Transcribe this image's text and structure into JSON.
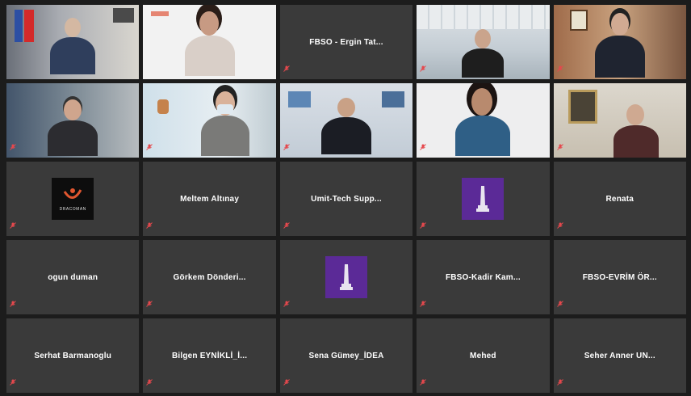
{
  "meeting": {
    "tiles": [
      {
        "type": "video",
        "label": "",
        "muted": false
      },
      {
        "type": "video",
        "label": "",
        "muted": false
      },
      {
        "type": "name",
        "name": "FBSO - Ergin Tat...",
        "label": "",
        "muted": true
      },
      {
        "type": "video",
        "label": "",
        "muted": true
      },
      {
        "type": "video",
        "label": "",
        "muted": true
      },
      {
        "type": "video",
        "label": "",
        "muted": true
      },
      {
        "type": "video",
        "label": "",
        "muted": true
      },
      {
        "type": "video",
        "label": "",
        "muted": true
      },
      {
        "type": "video",
        "label": "",
        "muted": true
      },
      {
        "type": "video",
        "label": "",
        "muted": true
      },
      {
        "type": "logo",
        "logo": "dracoman",
        "logo_text": "DRACOMAN",
        "label": "",
        "muted": true
      },
      {
        "type": "name",
        "name": "Meltem Altınay",
        "label": "",
        "muted": true
      },
      {
        "type": "name",
        "name": "Umit-Tech Supp...",
        "label": "",
        "muted": true
      },
      {
        "type": "logo",
        "logo": "tower",
        "label": "",
        "muted": true
      },
      {
        "type": "name",
        "name": "Renata",
        "label": "",
        "muted": true
      },
      {
        "type": "name",
        "name": "ogun duman",
        "label": "",
        "muted": true
      },
      {
        "type": "name",
        "name": "Görkem Dönderi...",
        "label": "",
        "muted": true
      },
      {
        "type": "logo",
        "logo": "tower",
        "label": "",
        "muted": true
      },
      {
        "type": "name",
        "name": "FBSO-Kadir Kam...",
        "label": "",
        "muted": true
      },
      {
        "type": "name",
        "name": "FBSO-EVRİM ÖR...",
        "label": "",
        "muted": true
      },
      {
        "type": "name",
        "name": "Serhat Barmanoglu",
        "label": "",
        "muted": true
      },
      {
        "type": "name",
        "name": "Bilgen EYNİKLİ_İ...",
        "label": "",
        "muted": true
      },
      {
        "type": "name",
        "name": "Sena Gümey_İDEA",
        "label": "",
        "muted": true
      },
      {
        "type": "name",
        "name": "Mehed",
        "label": "",
        "muted": true
      },
      {
        "type": "name",
        "name": "Seher Anner UN...",
        "label": "",
        "muted": true
      }
    ]
  },
  "colors": {
    "tile_bg": "#3a3a3a",
    "active_speaker": "#8ad24a",
    "mute_icon": "#e5484d",
    "purple_logo": "#5b2a97"
  },
  "icons": {
    "muted": "microphone-muted-icon"
  }
}
